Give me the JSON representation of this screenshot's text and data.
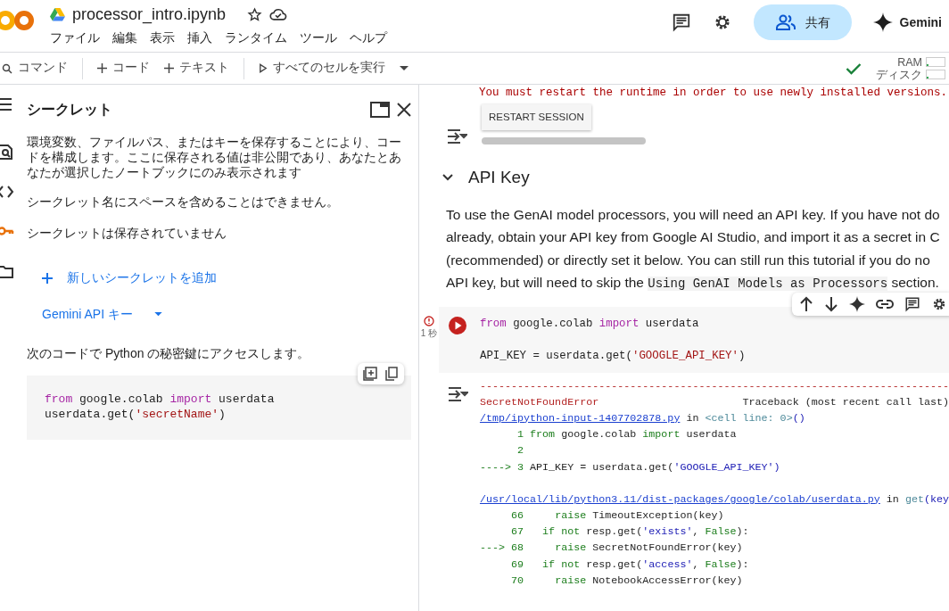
{
  "header": {
    "title": "processor_intro.ipynb",
    "menu": [
      "ファイル",
      "編集",
      "表示",
      "挿入",
      "ランタイム",
      "ツール",
      "ヘルプ"
    ],
    "share_label": "共有",
    "gemini_label": "Gemini"
  },
  "toolbar": {
    "command": "コマンド",
    "add_code": "コード",
    "add_text": "テキスト",
    "run_all": "すべてのセルを実行",
    "connected": true,
    "resources": [
      {
        "label": "RAM",
        "level": 0.1
      },
      {
        "label": "ディスク",
        "level": 0.1
      }
    ]
  },
  "rail": [
    {
      "selected": false
    },
    {
      "selected": false
    },
    {
      "selected": false
    },
    {
      "selected": true
    },
    {
      "selected": false
    }
  ],
  "sidebar": {
    "title": "シークレット",
    "description": "環境変数、ファイルパス、またはキーを保存することにより、コードを構成します。ここに保存される値は非公開であり、あなたとあなたが選択したノートブックにのみ表示されます",
    "notes": [
      "シークレット名にスペースを含めることはできません。",
      "シークレットは保存されていません"
    ],
    "add_label": "新しいシークレットを追加",
    "gemini_key_label": "Gemini API キー",
    "code_caption": "次のコードで Python の秘密鍵にアクセスします。",
    "code": [
      {
        "tokens": [
          {
            "kind": "kw",
            "text": "from"
          },
          {
            "kind": "plain",
            "text": " google.colab "
          },
          {
            "kind": "kw",
            "text": "import"
          },
          {
            "kind": "plain",
            "text": " userdata"
          }
        ]
      },
      {
        "tokens": [
          {
            "kind": "plain",
            "text": "userdata.get("
          },
          {
            "kind": "str",
            "text": "'secretName'"
          },
          {
            "kind": "plain",
            "text": ")"
          }
        ]
      }
    ]
  },
  "main": {
    "restart_message": "You must restart the runtime in order to use newly installed versions.",
    "restart_button": "RESTART SESSION",
    "section": {
      "title": "API Key",
      "expanded": true
    },
    "paragraph": {
      "lines": [
        "To use the GenAI model processors, you will need an API key. If you have not do",
        "already, obtain your API key from Google AI Studio, and import it as a secret in C",
        "(recommended) or directly set it below. You can still run this tutorial if you do no",
        "API key, but will need to skip the "
      ],
      "code": "Using GenAI Models as Processors",
      "after_code": " section."
    },
    "cell": {
      "exec_time": "1 秒",
      "code": [
        {
          "tokens": [
            {
              "kind": "kw",
              "text": "from"
            },
            {
              "kind": "plain",
              "text": " google.colab "
            },
            {
              "kind": "kw",
              "text": "import"
            },
            {
              "kind": "plain",
              "text": " userdata"
            }
          ]
        },
        {
          "gap_before": true,
          "tokens": [
            {
              "kind": "plain",
              "text": "API_KEY = userdata.get("
            },
            {
              "kind": "str",
              "text": "'GOOGLE_API_KEY'"
            },
            {
              "kind": "plain",
              "text": ")"
            }
          ]
        }
      ],
      "output": [
        {
          "tokens": [
            {
              "kind": "err",
              "text": "---------------------------------------------------------------------------"
            }
          ]
        },
        {
          "tokens": [
            {
              "kind": "err",
              "text": "SecretNotFoundError"
            },
            {
              "kind": "plain",
              "text": "                       Traceback (most recent call last)"
            }
          ]
        },
        {
          "tokens": [
            {
              "kind": "link",
              "text": "/tmp/ipython-input-1407702878.py"
            },
            {
              "kind": "plain",
              "text": " in "
            },
            {
              "kind": "meta",
              "text": "<cell line: 0>"
            },
            {
              "kind": "strb",
              "text": "()"
            }
          ]
        },
        {
          "tokens": [
            {
              "kind": "num",
              "text": "      1 "
            },
            {
              "kind": "kwg",
              "text": "from"
            },
            {
              "kind": "plain",
              "text": " google.colab "
            },
            {
              "kind": "kwg",
              "text": "import"
            },
            {
              "kind": "plain",
              "text": " userdata"
            }
          ]
        },
        {
          "tokens": [
            {
              "kind": "num",
              "text": "      2"
            }
          ]
        },
        {
          "tokens": [
            {
              "kind": "num",
              "text": "----> 3 "
            },
            {
              "kind": "plain",
              "text": "API_KEY = userdata.get("
            },
            {
              "kind": "strb",
              "text": "'GOOGLE_API_KEY'"
            },
            {
              "kind": "strb",
              "text": ")"
            }
          ]
        },
        {
          "gap_before": true,
          "tokens": [
            {
              "kind": "link",
              "text": "/usr/local/lib/python3.11/dist-packages/google/colab/userdata.py"
            },
            {
              "kind": "plain",
              "text": " in "
            },
            {
              "kind": "meta",
              "text": "get"
            },
            {
              "kind": "strb",
              "text": "(key"
            }
          ]
        },
        {
          "tokens": [
            {
              "kind": "num",
              "text": "     66     "
            },
            {
              "kind": "kwg",
              "text": "raise"
            },
            {
              "kind": "plain",
              "text": " TimeoutException(key)"
            }
          ]
        },
        {
          "tokens": [
            {
              "kind": "num",
              "text": "     67   "
            },
            {
              "kind": "kwg",
              "text": "if not"
            },
            {
              "kind": "plain",
              "text": " resp.get("
            },
            {
              "kind": "strb",
              "text": "'exists'"
            },
            {
              "kind": "plain",
              "text": ", "
            },
            {
              "kind": "kwg",
              "text": "False"
            },
            {
              "kind": "plain",
              "text": "):"
            }
          ]
        },
        {
          "tokens": [
            {
              "kind": "num",
              "text": "---> 68     "
            },
            {
              "kind": "kwg",
              "text": "raise"
            },
            {
              "kind": "plain",
              "text": " SecretNotFoundError(key)"
            }
          ]
        },
        {
          "tokens": [
            {
              "kind": "num",
              "text": "     69   "
            },
            {
              "kind": "kwg",
              "text": "if not"
            },
            {
              "kind": "plain",
              "text": " resp.get("
            },
            {
              "kind": "strb",
              "text": "'access'"
            },
            {
              "kind": "plain",
              "text": ", "
            },
            {
              "kind": "kwg",
              "text": "False"
            },
            {
              "kind": "plain",
              "text": "):"
            }
          ]
        },
        {
          "tokens": [
            {
              "kind": "num",
              "text": "     70     "
            },
            {
              "kind": "kwg",
              "text": "raise"
            },
            {
              "kind": "plain",
              "text": " NotebookAccessError(key)"
            }
          ]
        }
      ]
    }
  }
}
